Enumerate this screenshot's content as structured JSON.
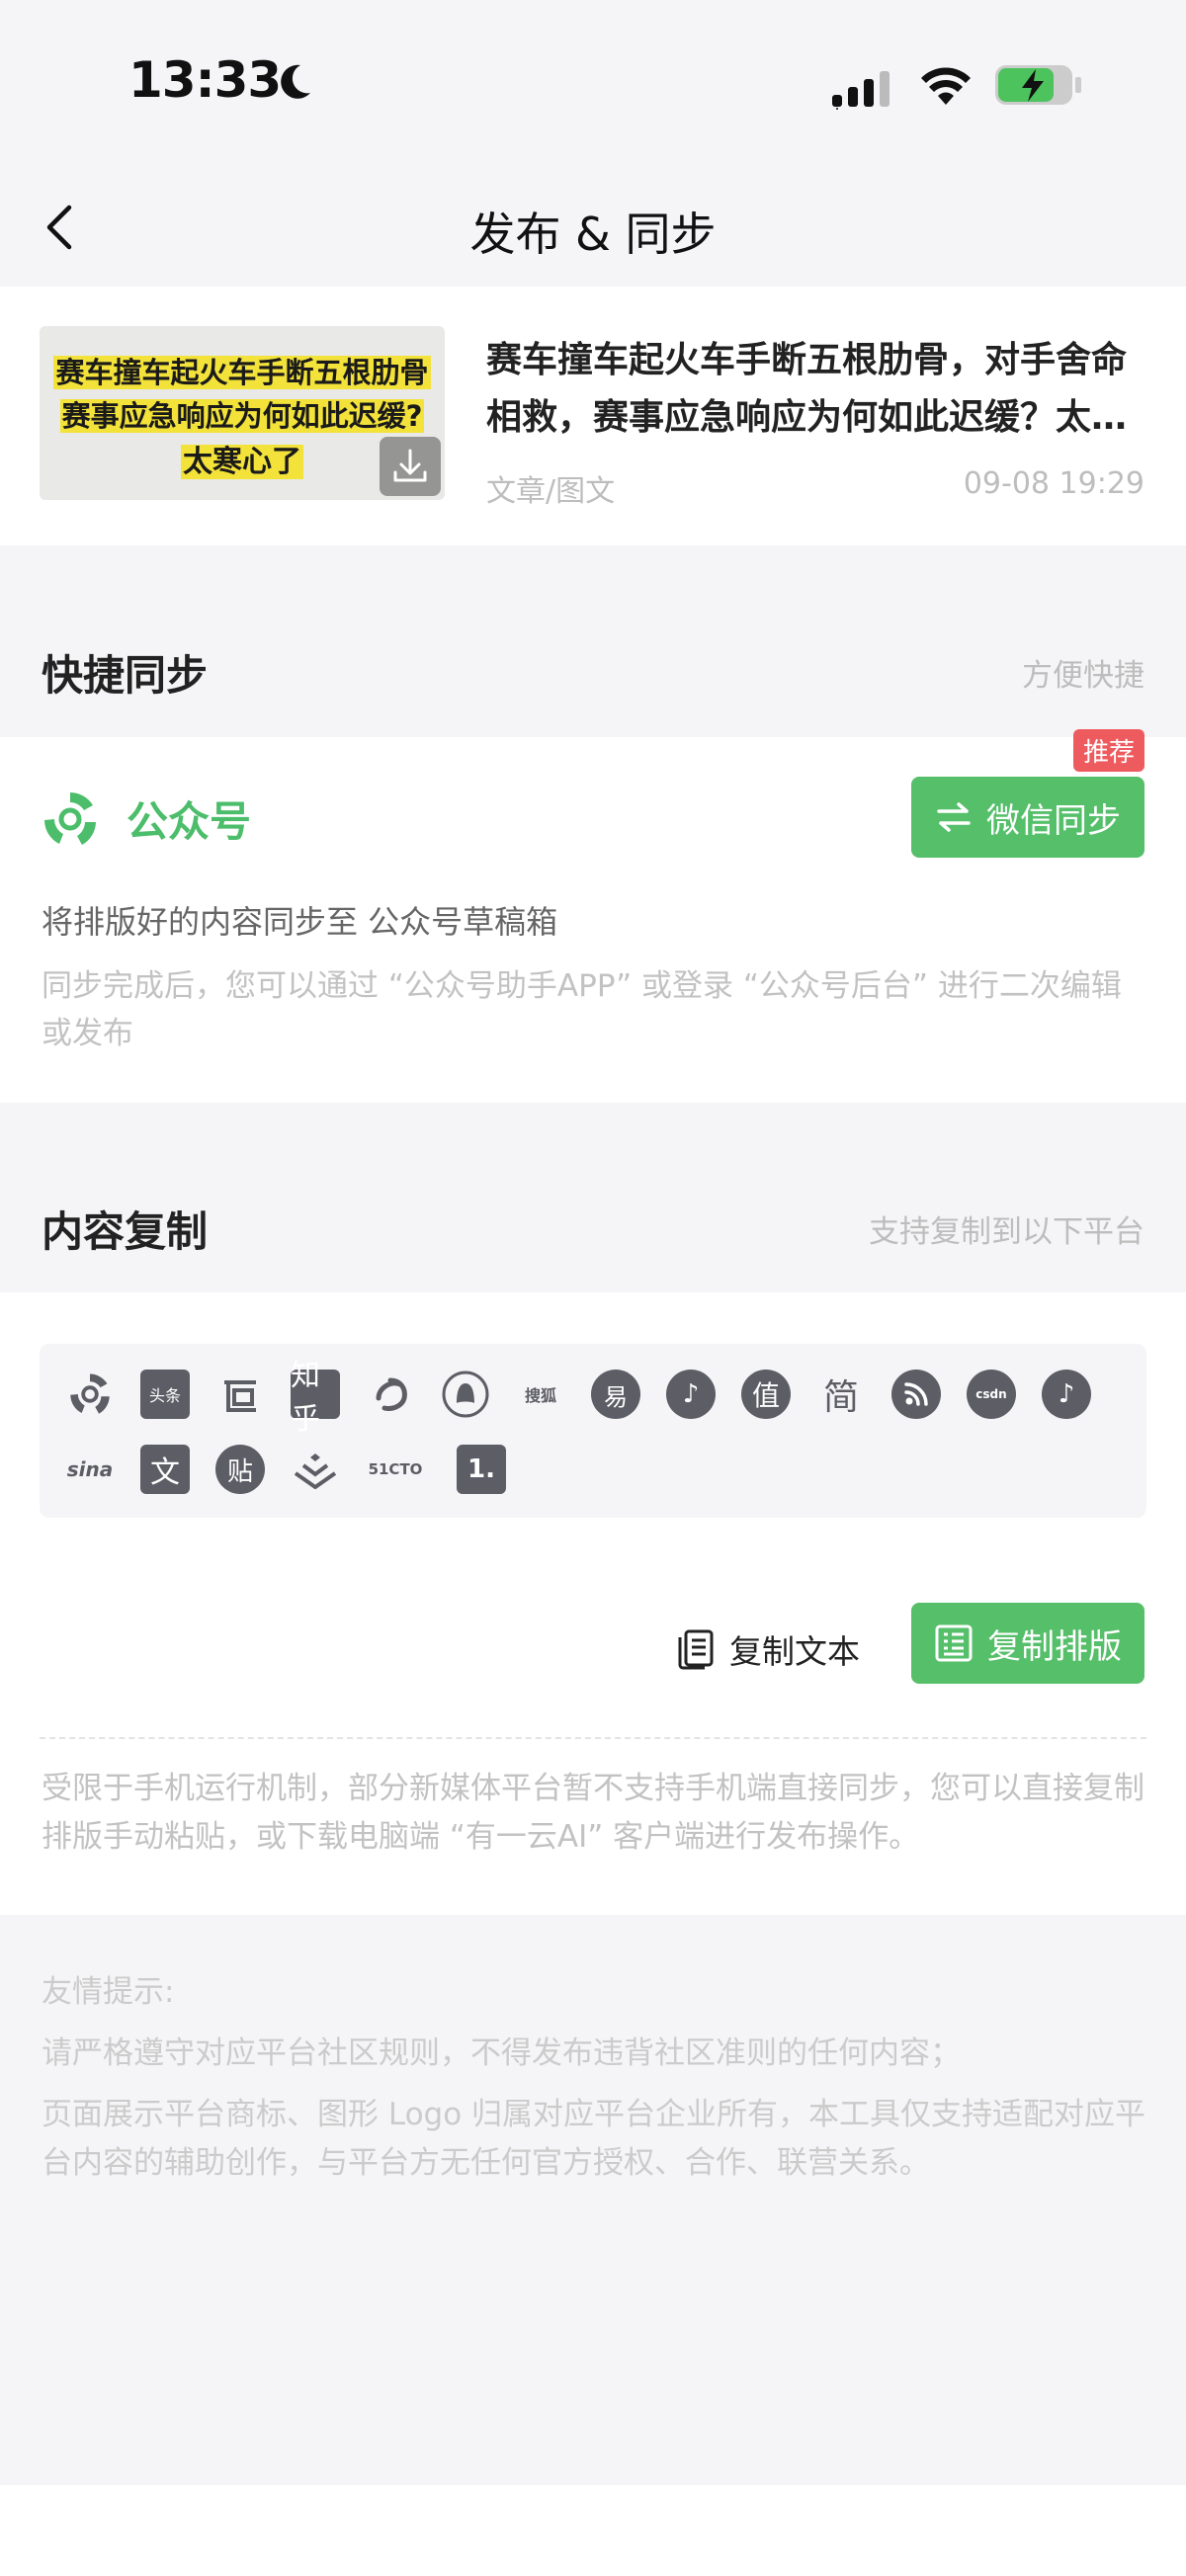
{
  "status_bar": {
    "time": "13:33"
  },
  "nav": {
    "title": "发布 & 同步"
  },
  "article": {
    "thumb_line1": "赛车撞车起火车手断五根肋骨",
    "thumb_line2": "赛事应急响应为何如此迟缓?",
    "thumb_line3": "太寒心了",
    "title": "赛车撞车起火车手断五根肋骨，对手舍命相救，赛事应急响应为何如此迟缓？太寒心了",
    "type": "文章/图文",
    "date": "09-08 19:29"
  },
  "quick_sync": {
    "title": "快捷同步",
    "subtitle": "方便快捷",
    "platform_name": "公众号",
    "badge": "推荐",
    "button_label": "微信同步",
    "description": "将排版好的内容同步至 公众号草稿箱",
    "note": "同步完成后，您可以通过 “公众号助手APP” 或登录 “公众号后台” 进行二次编辑或发布"
  },
  "content_copy": {
    "title": "内容复制",
    "subtitle": "支持复制到以下平台",
    "platforms_row1": [
      "公众号",
      "头条",
      "百家号",
      "知乎",
      "微博",
      "QQ",
      "搜狐",
      "网易",
      "抖音",
      "值",
      "简",
      "RSS",
      "csdn",
      "抖音"
    ],
    "platforms_row2": [
      "sina",
      "文",
      "贴",
      "掘金",
      "51CTO",
      "一点"
    ],
    "copy_text_label": "复制文本",
    "copy_layout_label": "复制排版",
    "note": "受限于手机运行机制，部分新媒体平台暂不支持手机端直接同步，您可以直接复制排版手动粘贴，或下载电脑端 “有一云AI” 客户端进行发布操作。"
  },
  "tips": {
    "heading": "友情提示:",
    "line1": "请严格遵守对应平台社区规则，不得发布违背社区准则的任何内容；",
    "line2": "页面展示平台商标、图形 Logo 归属对应平台企业所有，本工具仅支持适配对应平台内容的辅助创作，与平台方无任何官方授权、合作、联营关系。"
  },
  "colors": {
    "accent": "#55bf6a",
    "badge": "#ee5b5f",
    "muted": "#c2c2c2"
  }
}
